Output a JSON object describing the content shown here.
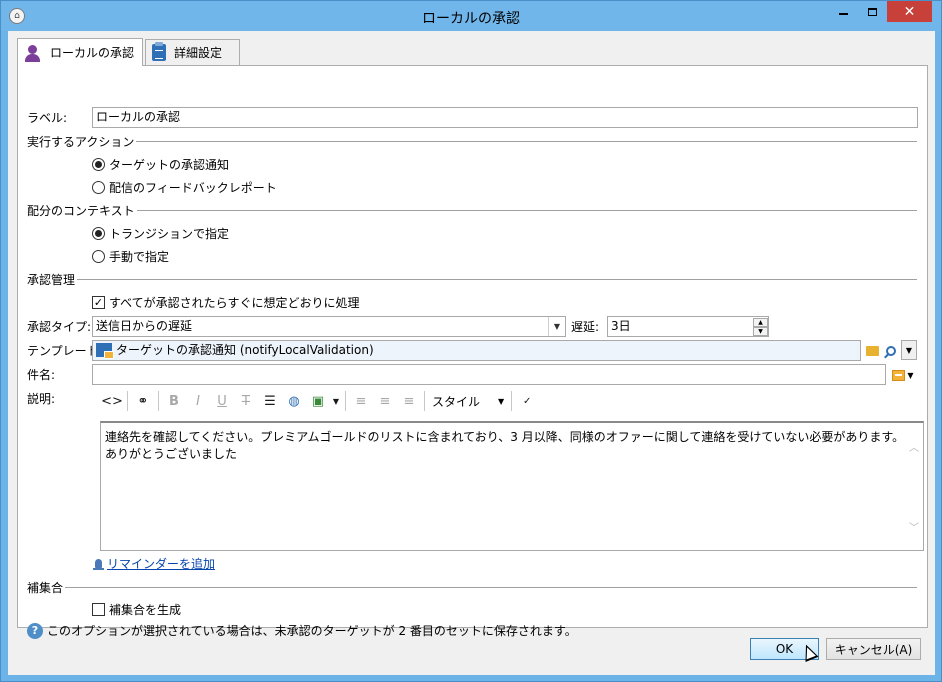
{
  "window": {
    "title": "ローカルの承認",
    "close_glyph": "✕"
  },
  "tabs": [
    {
      "label": "ローカルの承認",
      "icon": "user-approval-icon",
      "active": true
    },
    {
      "label": "詳細設定",
      "icon": "clipboard-icon",
      "active": false
    }
  ],
  "form": {
    "label_caption": "ラベル:",
    "label_value": "ローカルの承認",
    "action_section": "実行するアクション",
    "action_options": [
      "ターゲットの承認通知",
      "配信のフィードバックレポート"
    ],
    "context_section": "配分のコンテキスト",
    "context_options": [
      "トランジションで指定",
      "手動で指定"
    ],
    "approval_section": "承認管理",
    "approval_checkbox": "すべてが承認されたらすぐに想定どおりに処理",
    "approval_type_caption": "承認タイプ:",
    "approval_type_value": "送信日からの遅延",
    "delay_caption": "遅延:",
    "delay_value": "3日",
    "template_caption": "テンプレート:",
    "template_value": "ターゲットの承認通知 (notifyLocalValidation)",
    "subject_caption": "件名:",
    "subject_value": "",
    "description_caption": "説明:",
    "style_label": "スタイル",
    "description_lines": [
      "連絡先を確認してください。プレミアムゴールドのリストに含まれており、3 月以降、同様のオファーに関して連絡を受けていない必要があります。",
      "ありがとうございました"
    ],
    "reminder_link": "リマインダーを追加",
    "complement_section": "補集合",
    "complement_checkbox": "補集合を生成",
    "help_text": "このオプションが選択されている場合は、未承認のターゲットが 2 番目のセットに保存されます。"
  },
  "buttons": {
    "ok": "OK",
    "cancel": "キャンセル(A)"
  },
  "colors": {
    "titlebar": "#70b6ea",
    "close": "#c7403a",
    "link": "#0645ad"
  }
}
